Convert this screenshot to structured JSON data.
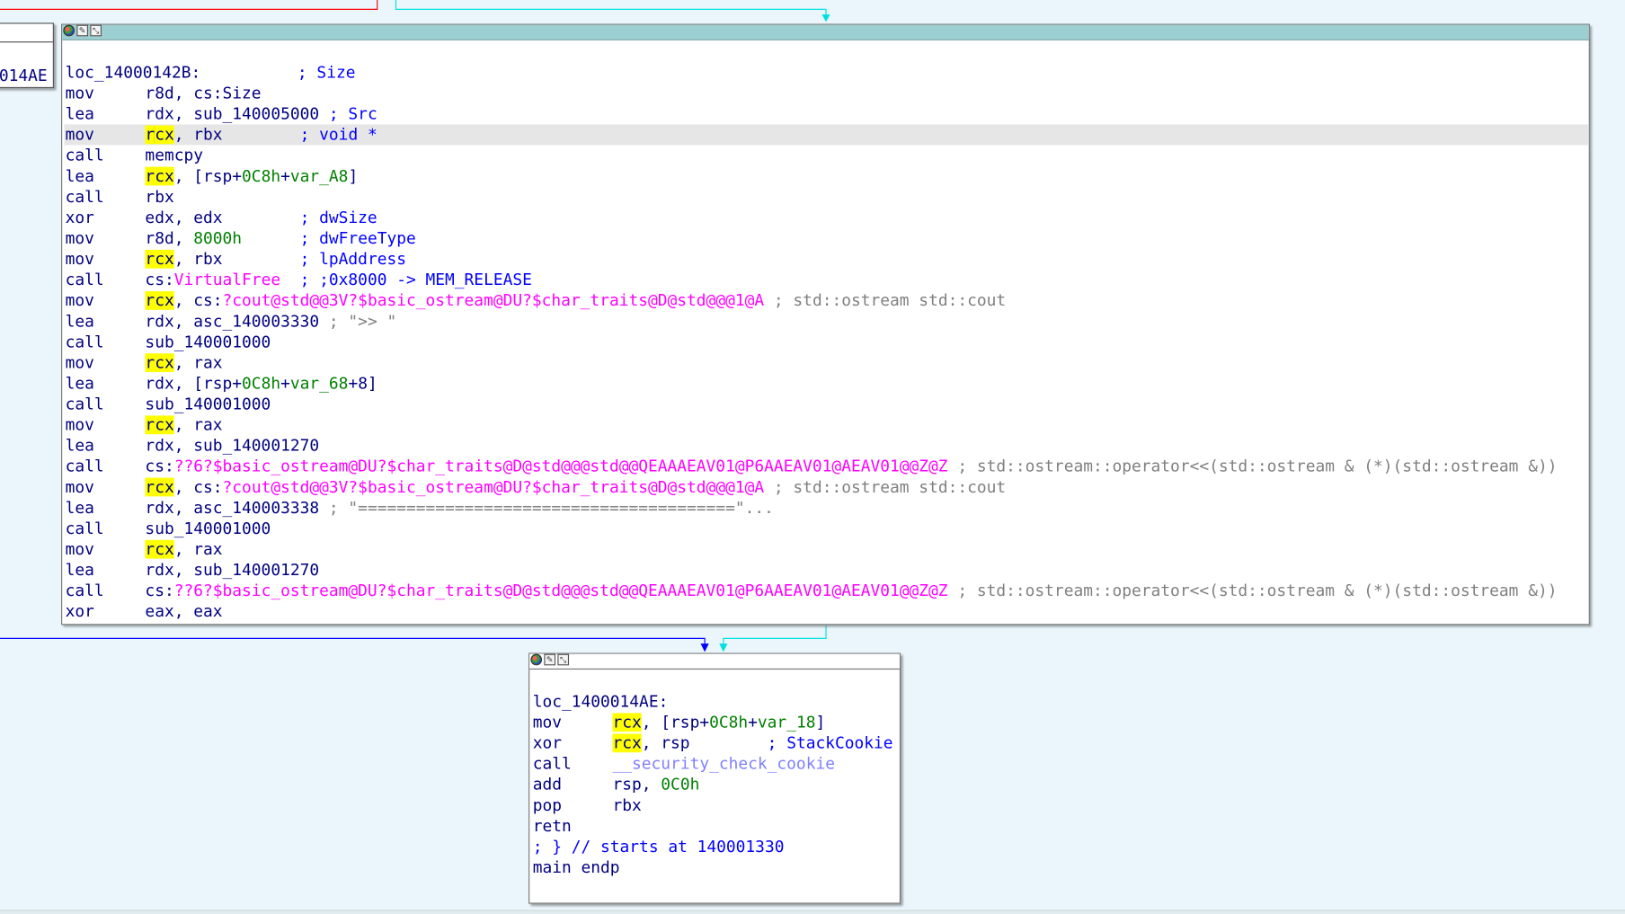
{
  "colors": {
    "background": "#eaf6fb",
    "header_active": "#9ccfd1",
    "mnemonic": "#000080",
    "number": "#008000",
    "import": "#ff00ff",
    "library": "#8080ff",
    "comment": "#808080",
    "register_highlight": "#ffff00",
    "edge_blue": "#0000ff",
    "edge_cyan": "#00e0e0",
    "edge_red": "#ff0000"
  },
  "left_node": {
    "label": "014AE"
  },
  "main_node": {
    "lines": [
      {
        "segs": [
          {
            "t": "loc_14000142B:",
            "c": "nm"
          },
          {
            "t": "          ; Size",
            "c": "cmtb"
          }
        ]
      },
      {
        "op": "mov",
        "segs": [
          {
            "t": "r8d, cs:Size",
            "c": "nm"
          }
        ]
      },
      {
        "op": "lea",
        "segs": [
          {
            "t": "rdx, sub_140005000",
            "c": "nm"
          },
          {
            "t": " ; Src",
            "c": "cmtb"
          }
        ]
      },
      {
        "op": "mov",
        "hl": true,
        "segs": [
          {
            "t": "r",
            "c": "reg"
          },
          {
            "caret": true
          },
          {
            "t": "cx",
            "c": "reg"
          },
          {
            "t": ", rbx",
            "c": "nm"
          },
          {
            "t": "        ; void *",
            "c": "cmtb"
          }
        ]
      },
      {
        "op": "call",
        "segs": [
          {
            "t": "memcpy",
            "c": "nm"
          }
        ]
      },
      {
        "op": "lea",
        "segs": [
          {
            "t": "rcx",
            "c": "reg"
          },
          {
            "t": ", [rsp+",
            "c": "nm"
          },
          {
            "t": "0C8h",
            "c": "num"
          },
          {
            "t": "+",
            "c": "nm"
          },
          {
            "t": "var_A8",
            "c": "var"
          },
          {
            "t": "]",
            "c": "nm"
          }
        ]
      },
      {
        "op": "call",
        "segs": [
          {
            "t": "rbx",
            "c": "nm"
          }
        ]
      },
      {
        "op": "xor",
        "segs": [
          {
            "t": "edx, edx",
            "c": "nm"
          },
          {
            "t": "        ; dwSize",
            "c": "cmtb"
          }
        ]
      },
      {
        "op": "mov",
        "segs": [
          {
            "t": "r8d, ",
            "c": "nm"
          },
          {
            "t": "8000h",
            "c": "num"
          },
          {
            "t": "      ; dwFreeType",
            "c": "cmtb"
          }
        ]
      },
      {
        "op": "mov",
        "segs": [
          {
            "t": "rcx",
            "c": "reg"
          },
          {
            "t": ", rbx",
            "c": "nm"
          },
          {
            "t": "        ; lpAddress",
            "c": "cmtb"
          }
        ]
      },
      {
        "op": "call",
        "segs": [
          {
            "t": "cs:",
            "c": "nm"
          },
          {
            "t": "VirtualFree",
            "c": "imp"
          },
          {
            "t": "  ; ;0x8000 -> MEM_RELEASE",
            "c": "cmtb"
          }
        ]
      },
      {
        "op": "mov",
        "segs": [
          {
            "t": "rcx",
            "c": "reg"
          },
          {
            "t": ", cs:",
            "c": "nm"
          },
          {
            "t": "?cout@std@@3V?$basic_ostream@DU?$char_traits@D@std@@@1@A",
            "c": "imp"
          },
          {
            "t": " ; std::ostream std::cout",
            "c": "cmt"
          }
        ]
      },
      {
        "op": "lea",
        "segs": [
          {
            "t": "rdx, asc_140003330",
            "c": "nm"
          },
          {
            "t": " ; \">> \"",
            "c": "cmt"
          }
        ]
      },
      {
        "op": "call",
        "segs": [
          {
            "t": "sub_140001000",
            "c": "nm"
          }
        ]
      },
      {
        "op": "mov",
        "segs": [
          {
            "t": "rcx",
            "c": "reg"
          },
          {
            "t": ", rax",
            "c": "nm"
          }
        ]
      },
      {
        "op": "lea",
        "segs": [
          {
            "t": "rdx, [rsp+",
            "c": "nm"
          },
          {
            "t": "0C8h",
            "c": "num"
          },
          {
            "t": "+",
            "c": "nm"
          },
          {
            "t": "var_68",
            "c": "var"
          },
          {
            "t": "+8]",
            "c": "nm"
          }
        ]
      },
      {
        "op": "call",
        "segs": [
          {
            "t": "sub_140001000",
            "c": "nm"
          }
        ]
      },
      {
        "op": "mov",
        "segs": [
          {
            "t": "rcx",
            "c": "reg"
          },
          {
            "t": ", rax",
            "c": "nm"
          }
        ]
      },
      {
        "op": "lea",
        "segs": [
          {
            "t": "rdx, sub_140001270",
            "c": "nm"
          }
        ]
      },
      {
        "op": "call",
        "segs": [
          {
            "t": "cs:",
            "c": "nm"
          },
          {
            "t": "??6?$basic_ostream@DU?$char_traits@D@std@@@std@@QEAAAEAV01@P6AAEAV01@AEAV01@@Z@Z",
            "c": "imp"
          },
          {
            "t": " ; std::ostream::operator<<(std::ostream & (*)(std::ostream &))",
            "c": "cmt"
          }
        ]
      },
      {
        "op": "mov",
        "segs": [
          {
            "t": "rcx",
            "c": "reg"
          },
          {
            "t": ", cs:",
            "c": "nm"
          },
          {
            "t": "?cout@std@@3V?$basic_ostream@DU?$char_traits@D@std@@@1@A",
            "c": "imp"
          },
          {
            "t": " ; std::ostream std::cout",
            "c": "cmt"
          }
        ]
      },
      {
        "op": "lea",
        "segs": [
          {
            "t": "rdx, asc_140003338",
            "c": "nm"
          },
          {
            "t": " ; \"=======================================\"...",
            "c": "cmt"
          }
        ]
      },
      {
        "op": "call",
        "segs": [
          {
            "t": "sub_140001000",
            "c": "nm"
          }
        ]
      },
      {
        "op": "mov",
        "segs": [
          {
            "t": "rcx",
            "c": "reg"
          },
          {
            "t": ", rax",
            "c": "nm"
          }
        ]
      },
      {
        "op": "lea",
        "segs": [
          {
            "t": "rdx, sub_140001270",
            "c": "nm"
          }
        ]
      },
      {
        "op": "call",
        "segs": [
          {
            "t": "cs:",
            "c": "nm"
          },
          {
            "t": "??6?$basic_ostream@DU?$char_traits@D@std@@@std@@QEAAAEAV01@P6AAEAV01@AEAV01@@Z@Z",
            "c": "imp"
          },
          {
            "t": " ; std::ostream::operator<<(std::ostream & (*)(std::ostream &))",
            "c": "cmt"
          }
        ]
      },
      {
        "op": "xor",
        "segs": [
          {
            "t": "eax, eax",
            "c": "nm"
          }
        ]
      }
    ]
  },
  "end_node": {
    "lines": [
      {
        "segs": [
          {
            "t": "loc_1400014AE:",
            "c": "nm"
          }
        ]
      },
      {
        "op": "mov",
        "segs": [
          {
            "t": "rcx",
            "c": "reg"
          },
          {
            "t": ", [rsp+",
            "c": "nm"
          },
          {
            "t": "0C8h",
            "c": "num"
          },
          {
            "t": "+",
            "c": "nm"
          },
          {
            "t": "var_18",
            "c": "var"
          },
          {
            "t": "]",
            "c": "nm"
          }
        ]
      },
      {
        "op": "xor",
        "segs": [
          {
            "t": "rcx",
            "c": "reg"
          },
          {
            "t": ", rsp",
            "c": "nm"
          },
          {
            "t": "        ; StackCookie",
            "c": "cmtb"
          }
        ]
      },
      {
        "op": "call",
        "segs": [
          {
            "t": "__security_check_cookie",
            "c": "lib"
          }
        ]
      },
      {
        "op": "add",
        "segs": [
          {
            "t": "rsp, ",
            "c": "nm"
          },
          {
            "t": "0C0h",
            "c": "num"
          }
        ]
      },
      {
        "op": "pop",
        "segs": [
          {
            "t": "rbx",
            "c": "nm"
          }
        ]
      },
      {
        "op": "retn",
        "segs": []
      },
      {
        "segs": [
          {
            "t": "; } // starts at 140001330",
            "c": "cmtb"
          }
        ]
      },
      {
        "segs": [
          {
            "t": "main endp",
            "c": "nm"
          }
        ]
      }
    ]
  }
}
